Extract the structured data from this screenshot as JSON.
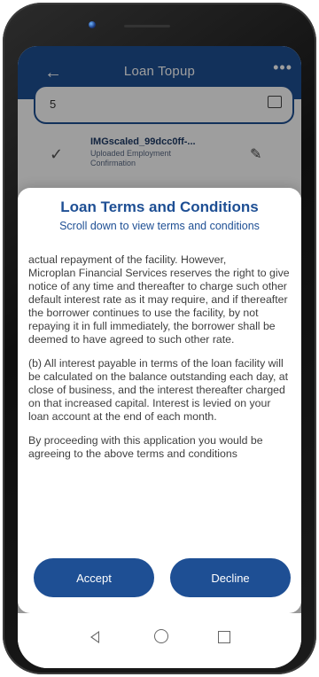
{
  "app_bar": {
    "title": "Loan Topup",
    "back_icon": "arrow-left-icon",
    "more_icon": "more-horizontal-icon"
  },
  "background": {
    "input_value": "5",
    "file": {
      "name": "IMGscaled_99dcc0ff-...",
      "description": "Uploaded Employment Confirmation"
    }
  },
  "modal": {
    "title": "Loan Terms and Conditions",
    "subtitle": "Scroll down to view terms and conditions",
    "cut_top_line": "actual repayment of the facility. However,",
    "paragraph_1": "Microplan Financial Services reserves the right to give notice of any time and thereafter to charge such other default interest rate as it may require, and if thereafter the borrower continues to use the facility, by not repaying it in full immediately, the borrower shall be deemed to have agreed to such other rate.",
    "paragraph_2": "(b) All interest payable in terms of the loan facility will be calculated on the balance outstanding each day, at close of business, and the interest thereafter charged on that increased capital. Interest is levied on your loan account at the end of each month.",
    "paragraph_3": "By proceeding with this application you would be agreeing to the above terms and conditions",
    "accept_label": "Accept",
    "decline_label": "Decline"
  },
  "colors": {
    "primary": "#1e4f94",
    "scrim": "rgba(0,0,0,0.38)"
  }
}
